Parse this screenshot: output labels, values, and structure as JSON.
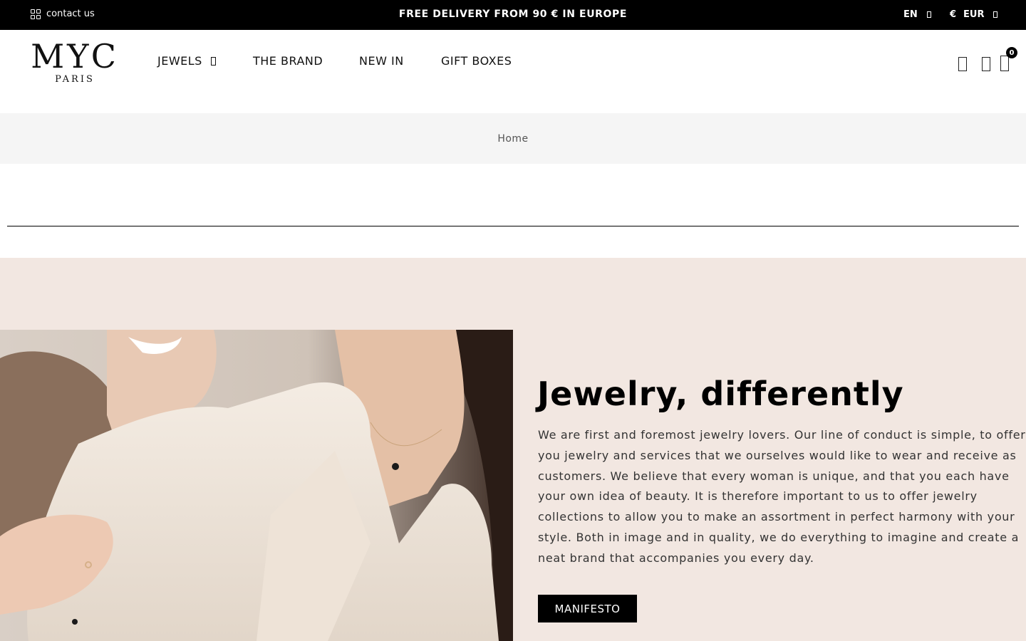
{
  "topbar": {
    "contact_label": "contact us",
    "contact_icon": "grid-icon",
    "promo": "FREE DELIVERY FROM 90 € IN EUROPE",
    "language": "EN",
    "currency_symbol": "€",
    "currency": "EUR"
  },
  "header": {
    "logo_brand": "MYC",
    "logo_city": "PARIS",
    "nav": [
      {
        "label": "JEWELS",
        "has_dropdown": true
      },
      {
        "label": "THE BRAND"
      },
      {
        "label": "NEW IN"
      },
      {
        "label": "GIFT BOXES"
      }
    ],
    "icons": [
      "search-icon",
      "user-icon",
      "bag-icon"
    ],
    "cart_count": "0"
  },
  "breadcrumb": {
    "home_label": "Home"
  },
  "hero": {
    "title": "Jewelry, differently",
    "text": "We are first and foremost jewelry lovers. Our line of conduct is simple, to offer you jewelry and services that we ourselves would like to wear and receive as customers. We believe that every woman is unique, and that you each have your own idea of beauty. It is therefore important to us to offer jewelry collections to allow you to make an assortment in perfect harmony with your style. Both in image and in quality, we do everything to imagine and create a neat brand that accompanies you every day.",
    "button_label": "MANIFESTO",
    "background_color": "#f2e7e1"
  },
  "colors": {
    "topbar_bg": "#000000",
    "breadcrumb_bg": "#f5f5f5",
    "accent": "#000000"
  }
}
